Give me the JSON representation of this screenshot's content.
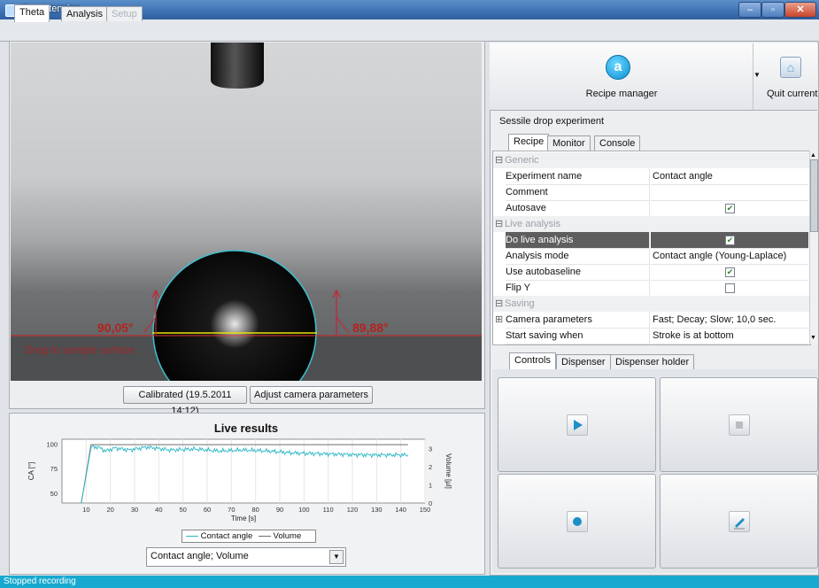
{
  "window": {
    "title": "OneAttension"
  },
  "main_tabs": [
    {
      "label": "Theta",
      "active": true
    },
    {
      "label": "Analysis",
      "active": false
    },
    {
      "label": "Setup",
      "active": false
    }
  ],
  "camera": {
    "angle_left": "90,05°",
    "angle_right": "89,88°",
    "hint": "Drag to sample surface",
    "calibrated_button": "Calibrated (19.5.2011 14:12)",
    "adjust_button": "Adjust camera parameters"
  },
  "live_results": {
    "title": "Live results",
    "series_select": "Contact angle; Volume"
  },
  "chart_data": {
    "type": "line",
    "title": "Live results",
    "xlabel": "Time [s]",
    "ylabel": "CA [°]",
    "y2label": "Volume [µl]",
    "xlim": [
      0,
      150
    ],
    "ylim": [
      40,
      105
    ],
    "y2lim": [
      0,
      3.5
    ],
    "x_ticks": [
      10,
      20,
      30,
      40,
      50,
      60,
      70,
      80,
      90,
      100,
      110,
      120,
      130,
      140,
      150
    ],
    "y_ticks": [
      50,
      75,
      100
    ],
    "y2_ticks": [
      0,
      1,
      2,
      3
    ],
    "series": [
      {
        "name": "Contact angle",
        "color": "#29b6c6",
        "x": [
          8,
          12,
          15,
          18,
          22,
          28,
          35,
          45,
          55,
          65,
          75,
          85,
          95,
          110,
          125,
          143
        ],
        "y": [
          40,
          97,
          97,
          93,
          96,
          94,
          97,
          94,
          95,
          93,
          94,
          93,
          91,
          90,
          89,
          89
        ]
      },
      {
        "name": "Volume",
        "color": "#6f6f6f",
        "x": [
          8,
          12,
          143
        ],
        "y": [
          0,
          3.2,
          3.2
        ]
      }
    ],
    "legend": "bottom"
  },
  "toolbar": {
    "recipe_manager": "Recipe manager",
    "quit": "Quit current",
    "recipe_icon_letter": "a"
  },
  "experiment_title": "Sessile drop experiment",
  "recipe_tabs": [
    "Recipe",
    "Monitor",
    "Console"
  ],
  "properties": {
    "cat_generic": "Generic",
    "cat_live": "Live analysis",
    "cat_saving": "Saving",
    "experiment_name": {
      "name": "Experiment name",
      "value": "Contact angle"
    },
    "comment": {
      "name": "Comment",
      "value": ""
    },
    "autosave": {
      "name": "Autosave",
      "checked": true
    },
    "do_live": {
      "name": "Do live analysis",
      "checked": true
    },
    "analysis_mode": {
      "name": "Analysis mode",
      "value": "Contact angle (Young-Laplace)"
    },
    "autobaseline": {
      "name": "Use autobaseline",
      "checked": true
    },
    "flip_y": {
      "name": "Flip Y",
      "checked": false
    },
    "camera_params": {
      "name": "Camera parameters",
      "value": "Fast; Decay; Slow; 10,0 sec."
    },
    "start_saving": {
      "name": "Start saving when",
      "value": "Stroke is at bottom"
    }
  },
  "control_tabs": [
    "Controls",
    "Dispenser",
    "Dispenser holder"
  ],
  "status": "Stopped recording"
}
